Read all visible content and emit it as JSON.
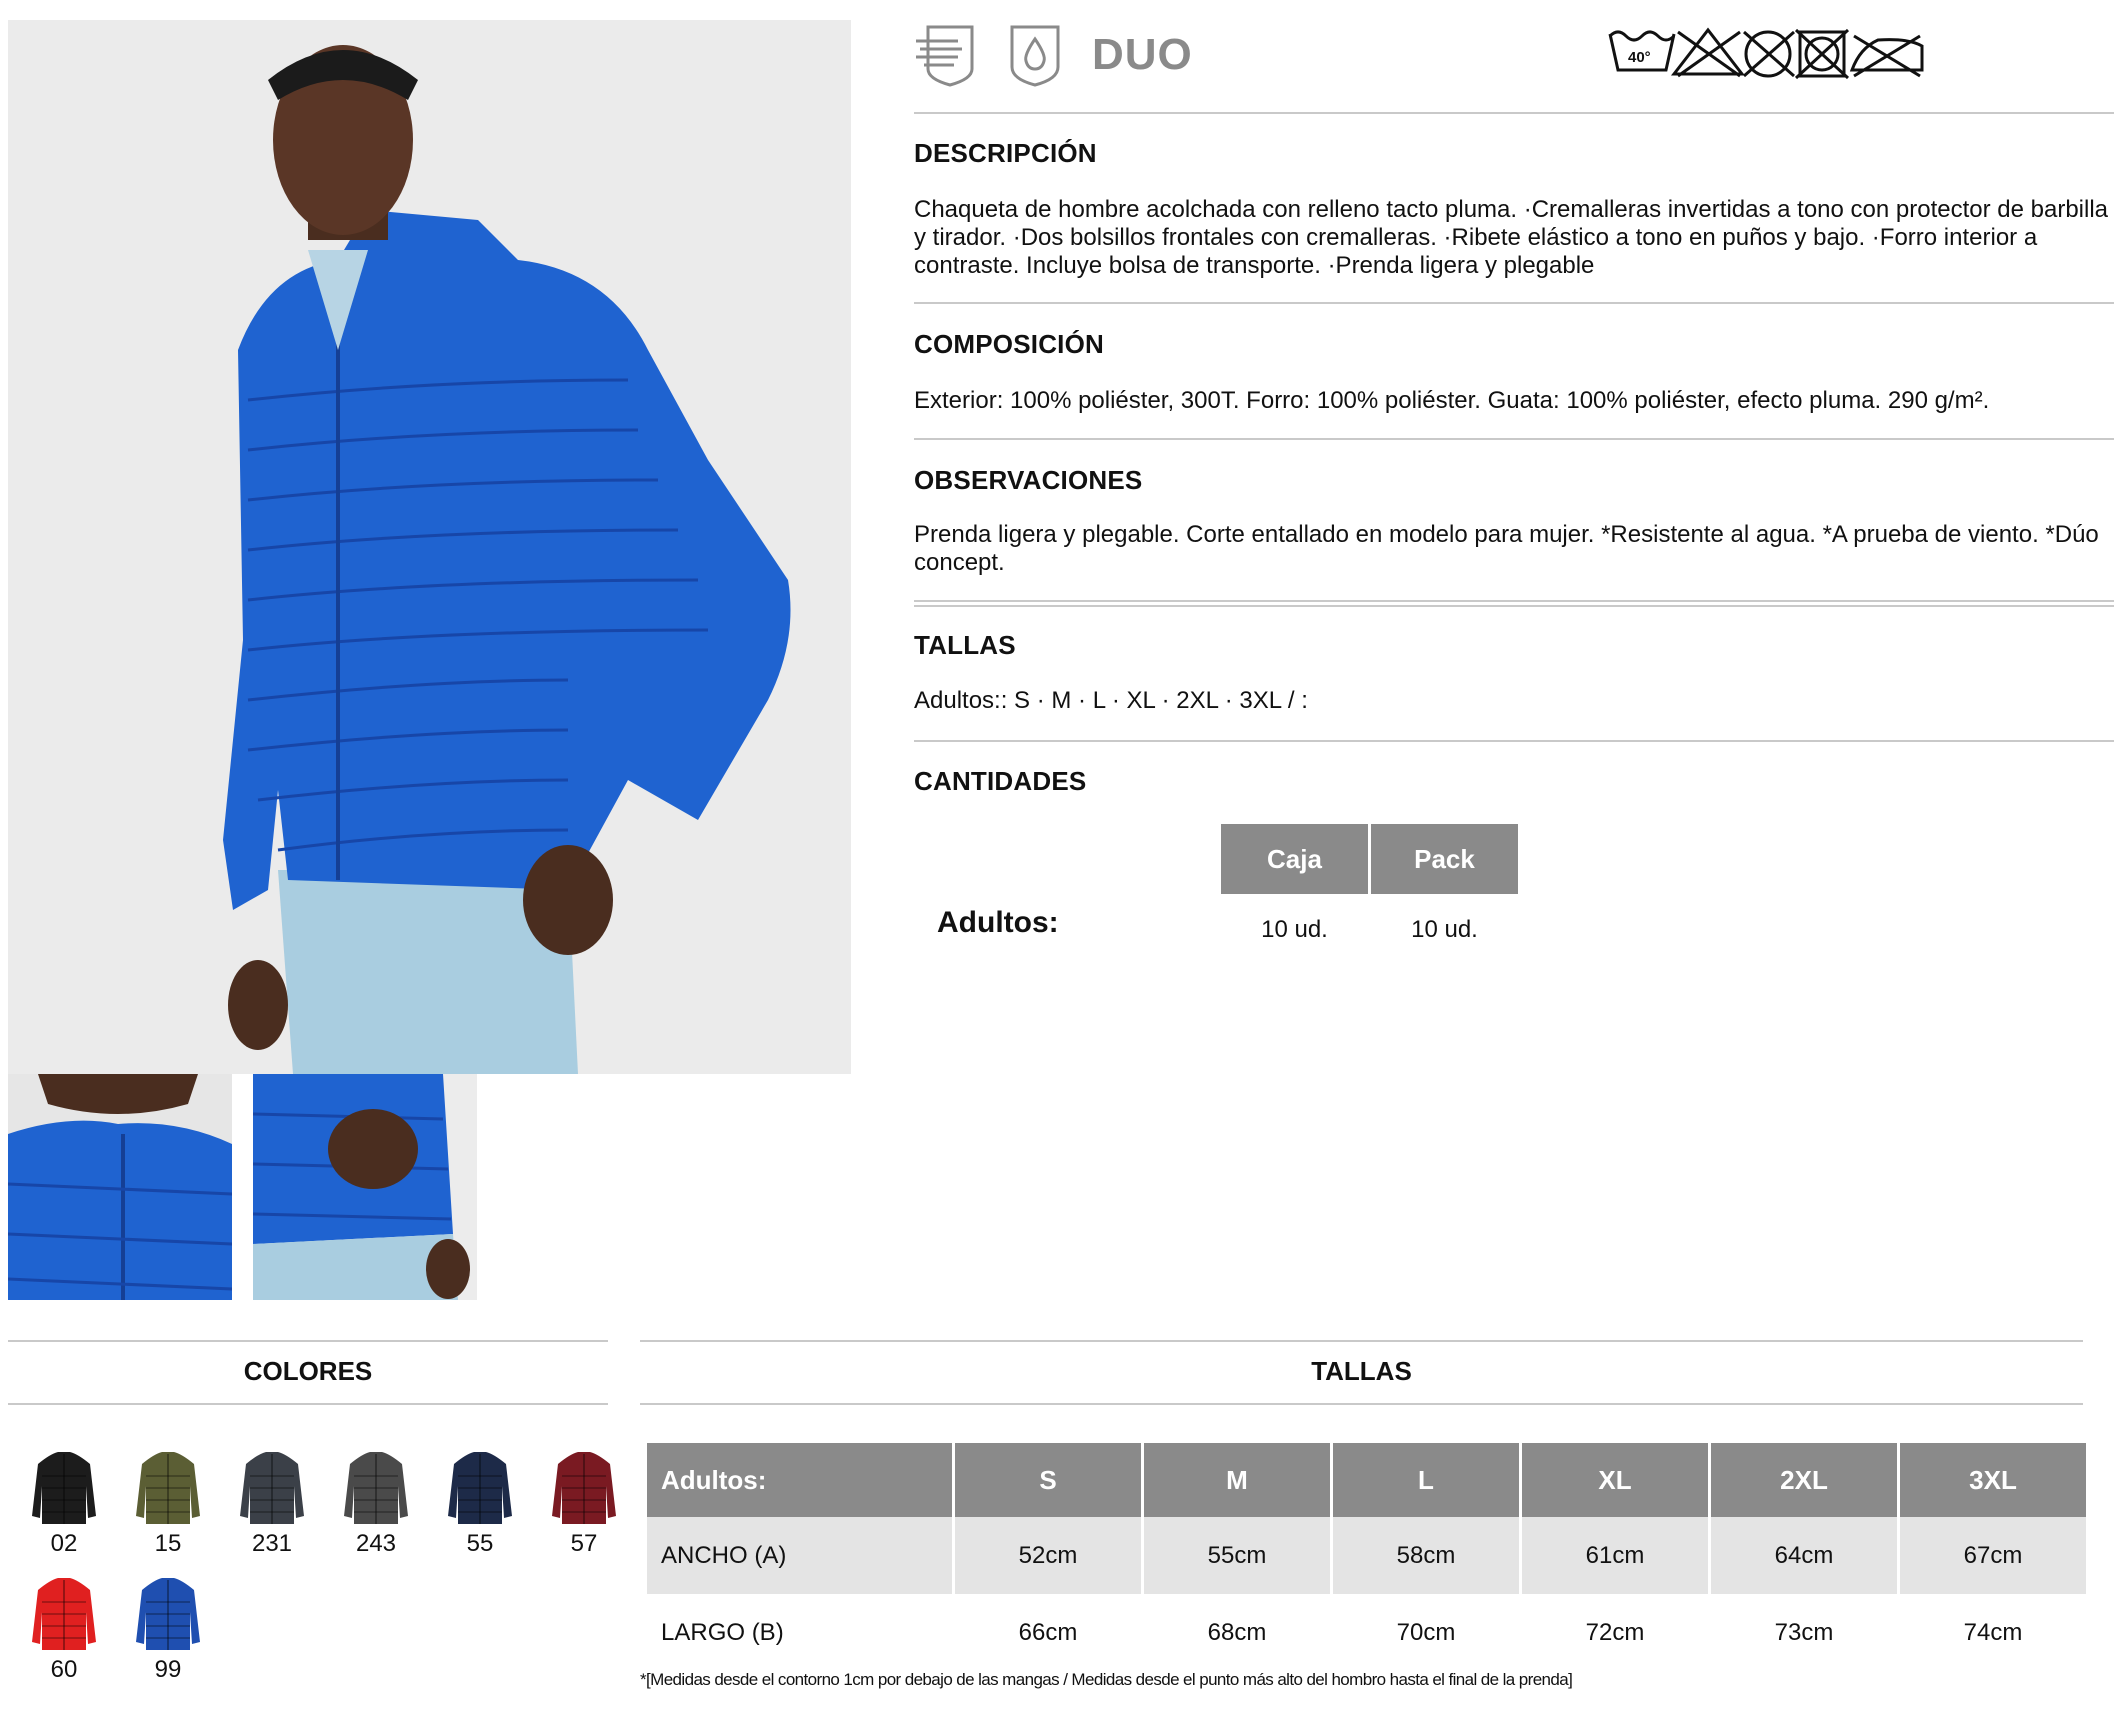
{
  "feature_icons": [
    "wind-resistant-icon",
    "water-resistant-icon"
  ],
  "duo_label": "DUO",
  "care": {
    "wash_temp": "40°",
    "symbols": [
      "wash-40-icon",
      "no-bleach-icon",
      "no-dry-clean-icon",
      "no-tumble-dry-icon",
      "no-iron-icon"
    ]
  },
  "descripcion": {
    "title": "DESCRIPCIÓN",
    "text": "Chaqueta de hombre acolchada con relleno tacto pluma. ·Cremalleras invertidas a tono con protector de barbilla y tirador. ·Dos bolsillos frontales con cremalleras. ·Ribete elástico a tono en puños y bajo. ·Forro interior a contraste. Incluye bolsa de transporte. ·Prenda ligera y plegable"
  },
  "composicion": {
    "title": "COMPOSICIÓN",
    "text": "Exterior: 100% poliéster, 300T. Forro: 100% poliéster. Guata: 100% poliéster, efecto pluma. 290 g/m²."
  },
  "observaciones": {
    "title": "OBSERVACIONES",
    "text": "Prenda ligera y plegable. Corte entallado en modelo para mujer. *Resistente al agua. *A prueba de viento. *Dúo concept."
  },
  "tallas_top": {
    "title": "TALLAS",
    "text": "Adultos:: S · M · L · XL · 2XL · 3XL / :"
  },
  "cantidades": {
    "title": "CANTIDADES",
    "headers": [
      "Caja",
      "Pack"
    ],
    "row_label": "Adultos:",
    "values": [
      "10 ud.",
      "10 ud."
    ]
  },
  "colores": {
    "title": "COLORES",
    "items": [
      {
        "code": "02",
        "color": "#1c1c1c"
      },
      {
        "code": "15",
        "color": "#5b5e34"
      },
      {
        "code": "231",
        "color": "#3b4048"
      },
      {
        "code": "243",
        "color": "#4a4a4a"
      },
      {
        "code": "55",
        "color": "#1d2a48"
      },
      {
        "code": "57",
        "color": "#7a1a22"
      },
      {
        "code": "60",
        "color": "#e02020"
      },
      {
        "code": "99",
        "color": "#1f4fb0"
      }
    ]
  },
  "tallas_table": {
    "title": "TALLAS",
    "headers": [
      "Adultos:",
      "S",
      "M",
      "L",
      "XL",
      "2XL",
      "3XL"
    ],
    "rows": [
      {
        "label": "ANCHO (A)",
        "values": [
          "52cm",
          "55cm",
          "58cm",
          "61cm",
          "64cm",
          "67cm"
        ]
      },
      {
        "label": "LARGO (B)",
        "values": [
          "66cm",
          "68cm",
          "70cm",
          "72cm",
          "73cm",
          "74cm"
        ]
      }
    ],
    "footnote": "*[Medidas desde el contorno 1cm por debajo de las mangas / Medidas desde el punto más alto del hombro hasta el final de la prenda]"
  },
  "colors": {
    "jacket_blue": "#1f63d0",
    "header_grey": "#8a8a8a",
    "row_grey": "#e4e4e4"
  }
}
